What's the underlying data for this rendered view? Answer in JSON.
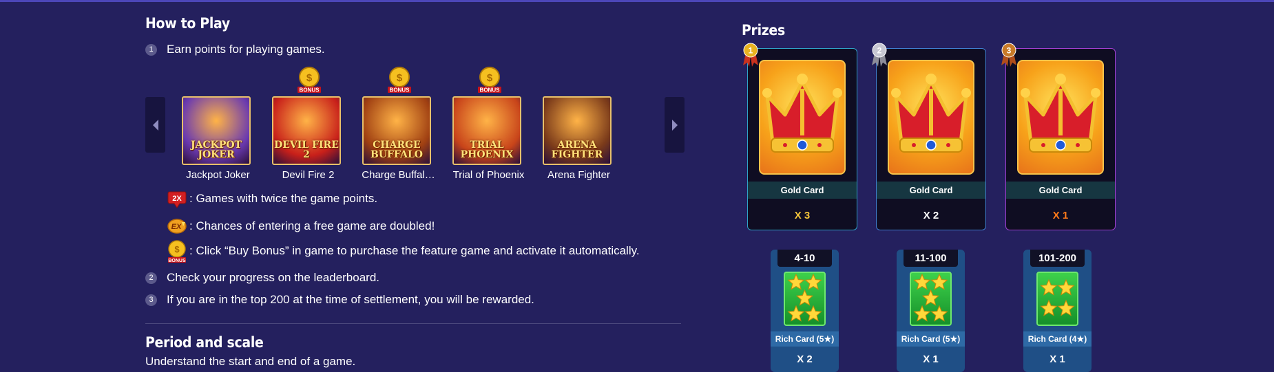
{
  "how_to_play": {
    "title": "How to Play",
    "steps": [
      {
        "num": "1",
        "text": "Earn points for playing games."
      },
      {
        "num": "2",
        "text": "Check your progress on the leaderboard."
      },
      {
        "num": "3",
        "text": "If you are in the top 200 at the time of settlement, you will be rewarded."
      }
    ],
    "games": [
      {
        "name": "Jackpot Joker",
        "art_text": "JACKPOT\nJOKER",
        "bonus": false,
        "bg": "#6a3ab0"
      },
      {
        "name": "Devil Fire 2",
        "art_text": "DEVIL FIRE 2",
        "bonus": true,
        "bg": "#c8201a"
      },
      {
        "name": "Charge Buffal…",
        "art_text": "CHARGE\nBUFFALO",
        "bonus": true,
        "bg": "#a04012"
      },
      {
        "name": "Trial of Phoenix",
        "art_text": "TRIAL\nPHOENIX",
        "bonus": true,
        "bg": "#c8441a"
      },
      {
        "name": "Arena Fighter",
        "art_text": "ARENA FIGHTER",
        "bonus": false,
        "bg": "#7a3a1a"
      }
    ],
    "bonus_badge": "BONUS",
    "legend": [
      {
        "icon": "2x-icon",
        "badge": "2X",
        "text": ": Games with twice the game points."
      },
      {
        "icon": "ex-icon",
        "badge": "EX",
        "text": ": Chances of entering a free game are doubled!"
      },
      {
        "icon": "bonus-coin-icon",
        "badge": "BONUS",
        "text": ": Click “Buy Bonus” in game to purchase the feature game and activate it automatically."
      }
    ]
  },
  "period": {
    "title": "Period and scale",
    "subtitle": "Understand the start and end of a game."
  },
  "prizes": {
    "title": "Prizes",
    "top_cards": [
      {
        "rank": "1",
        "label": "Gold Card",
        "qty": "X 3",
        "qty_color": "#f5c53a",
        "border": "#2fa3c7",
        "medal": "#e8b320",
        "ribbon": "#c8321e"
      },
      {
        "rank": "2",
        "label": "Gold Card",
        "qty": "X 2",
        "qty_color": "#ffffff",
        "border": "#3f7fd0",
        "medal": "#c7c7d2",
        "ribbon": "#8d8d99"
      },
      {
        "rank": "3",
        "label": "Gold Card",
        "qty": "X 1",
        "qty_color": "#ff7a1a",
        "border": "#a23fd0",
        "medal": "#c87a28",
        "ribbon": "#b04e1a"
      }
    ],
    "rich_cards": [
      {
        "range": "4-10",
        "label": "Rich Card (5★)",
        "qty": "X 2",
        "stars": 5
      },
      {
        "range": "11-100",
        "label": "Rich Card (5★)",
        "qty": "X 1",
        "stars": 5
      },
      {
        "range": "101-200",
        "label": "Rich Card (4★)",
        "qty": "X 1",
        "stars": 4
      }
    ]
  }
}
